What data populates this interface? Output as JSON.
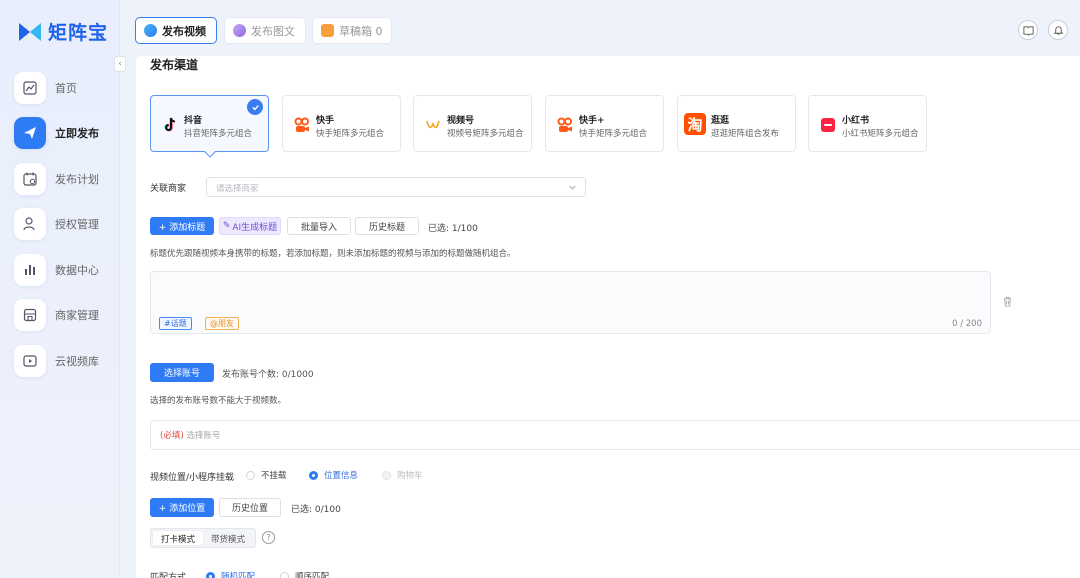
{
  "app": {
    "name": "矩阵宝",
    "brand_color": "#1f63e9"
  },
  "sidebar": {
    "collapse_icon": "‹",
    "items": [
      {
        "label": "首页",
        "icon": "chart-line-icon",
        "active": false
      },
      {
        "label": "立即发布",
        "icon": "paper-plane-icon",
        "active": true
      },
      {
        "label": "发布计划",
        "icon": "calendar-icon",
        "active": false
      },
      {
        "label": "授权管理",
        "icon": "user-key-icon",
        "active": false
      },
      {
        "label": "数据中心",
        "icon": "bar-chart-icon",
        "active": false
      },
      {
        "label": "商家管理",
        "icon": "store-icon",
        "active": false
      },
      {
        "label": "云视频库",
        "icon": "video-library-icon",
        "active": false
      }
    ]
  },
  "topbar": {
    "tabs": [
      {
        "label": "发布视频",
        "active": true
      },
      {
        "label": "发布图文",
        "active": false
      },
      {
        "label": "草稿箱 0",
        "active": false
      }
    ],
    "icons": [
      "book-icon",
      "bell-icon"
    ]
  },
  "main": {
    "section_title": "发布渠道",
    "channels": [
      {
        "name": "抖音",
        "desc": "抖音矩阵多元组合",
        "icon": "douyin-icon",
        "selected": true
      },
      {
        "name": "快手",
        "desc": "快手矩阵多元组合",
        "icon": "kuaishou-icon",
        "selected": false
      },
      {
        "name": "视频号",
        "desc": "视频号矩阵多元组合",
        "icon": "channels-icon",
        "selected": false
      },
      {
        "name": "快手+",
        "desc": "快手矩阵多元组合",
        "icon": "kuaishou-plus-icon",
        "selected": false
      },
      {
        "name": "逛逛",
        "desc": "逛逛矩阵组合发布",
        "icon": "taobao-icon",
        "selected": false
      },
      {
        "name": "小红书",
        "desc": "小红书矩阵多元组合",
        "icon": "xiaohongshu-icon",
        "selected": false
      }
    ],
    "merchant": {
      "label": "关联商家",
      "placeholder": "请选择商家"
    },
    "title_section": {
      "add_title": "+ 添加标题",
      "ai_title": "AI生成标题",
      "batch_import": "批量导入",
      "history_title": "历史标题",
      "selected": "已选: 1/100",
      "hint": "标题优先跟随视频本身携带的标题，若添加标题，则未添加标题的视频与添加的标题做随机组合。",
      "tag_topic": "#话题",
      "tag_friend": "@朋友",
      "counter": "0 / 200"
    },
    "account_section": {
      "select_btn": "选择账号",
      "count_label": "发布账号个数: 0/1000",
      "hint": "选择的发布账号数不能大于视频数。",
      "required": "(必填)",
      "placeholder": "选择账号"
    },
    "position_section": {
      "label": "视频位置/小程序挂载",
      "options": [
        {
          "label": "不挂载",
          "state": "off"
        },
        {
          "label": "位置信息",
          "state": "on"
        },
        {
          "label": "购物车",
          "state": "disabled"
        }
      ],
      "add_position": "+ 添加位置",
      "history_position": "历史位置",
      "selected": "已选: 0/100",
      "modes": [
        {
          "label": "打卡模式",
          "active": true
        },
        {
          "label": "带货模式",
          "active": false
        }
      ],
      "help": "?"
    },
    "match_section": {
      "label": "匹配方式",
      "options": [
        {
          "label": "随机匹配",
          "state": "on"
        },
        {
          "label": "顺序匹配",
          "state": "off"
        }
      ]
    }
  }
}
